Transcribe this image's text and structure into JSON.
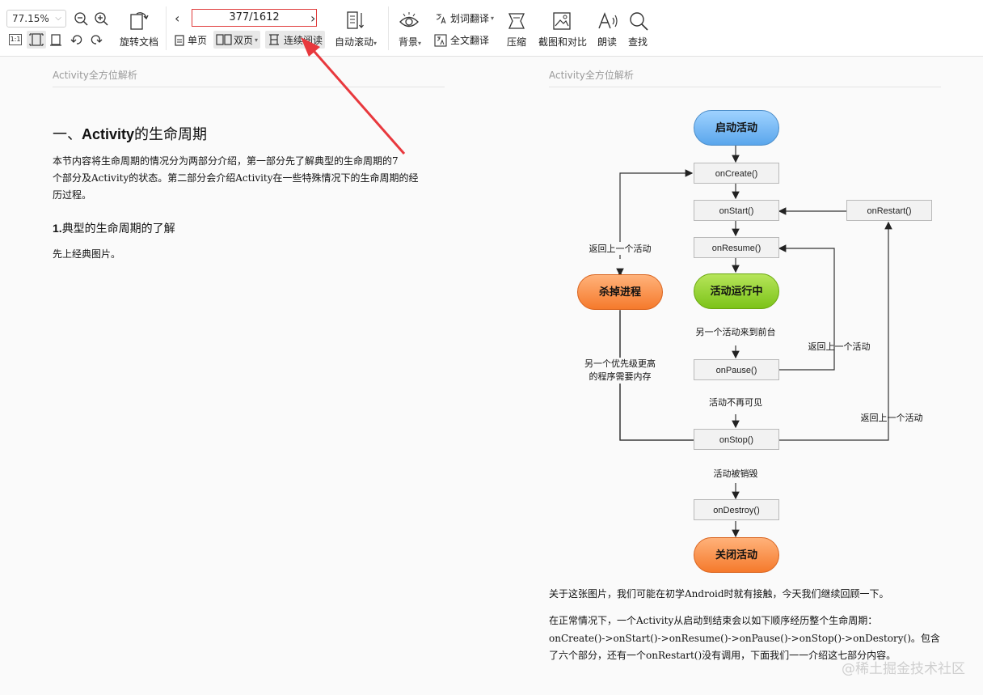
{
  "toolbar": {
    "zoom": "77.15%",
    "rotate_label": "旋转文档",
    "page_indicator": "377/1612",
    "single_page": "单页",
    "double_page": "双页",
    "continuous_read": "连续阅读",
    "auto_scroll": "自动滚动",
    "background": "背景",
    "word_translate": "划词翻译",
    "full_translate": "全文翻译",
    "compress": "压缩",
    "screenshot_compare": "截图和对比",
    "read_aloud": "朗读",
    "find": "查找",
    "fit_label": "1:1",
    "annotation_color": "#e8383d"
  },
  "left_page": {
    "header": "Activity全方位解析",
    "title_prefix": "一、",
    "title_bold": "Activity",
    "title_suffix": "的生命周期",
    "intro_line1": "本节内容将生命周期的情况分为两部分介绍，第一部分先了解典型的生命周期的7",
    "intro_line2": "个部分及Activity的状态。第二部分会介绍Activity在一些特殊情况下的生命周期的经",
    "intro_line3": "历过程。",
    "section_num": "1.",
    "section_title": "典型的生命周期的了解",
    "section_body": "先上经典图片。"
  },
  "right_page": {
    "header": "Activity全方位解析",
    "diagram": {
      "start": "启动活动",
      "on_create": "onCreate()",
      "on_start": "onStart()",
      "on_restart": "onRestart()",
      "on_resume": "onResume()",
      "running": "活动运行中",
      "to_front": "另一个活动来到前台",
      "back_to_activity_1": "返回上一个活动",
      "on_pause": "onPause()",
      "not_visible": "活动不再可见",
      "back_to_activity_2": "返回上一个活动",
      "on_stop": "onStop()",
      "destroyed": "活动被销毁",
      "on_destroy": "onDestroy()",
      "close": "关闭活动",
      "kill": "杀掉进程",
      "back_to_activity_3": "返回上一个活动",
      "higher_priority_1": "另一个优先级更高",
      "higher_priority_2": "的程序需要内存"
    },
    "body_line1": "关于这张图片，我们可能在初学Android时就有接触，今天我们继续回顾一下。",
    "body_line2": "在正常情况下，一个Activity从启动到结束会以如下顺序经历整个生命周期：",
    "body_line3": "onCreate()->onStart()->onResume()->onPause()->onStop()->onDestory()。包含",
    "body_line4": "了六个部分，还有一个onRestart()没有调用，下面我们一一介绍这七部分内容。"
  },
  "watermark": "@稀土掘金技术社区"
}
